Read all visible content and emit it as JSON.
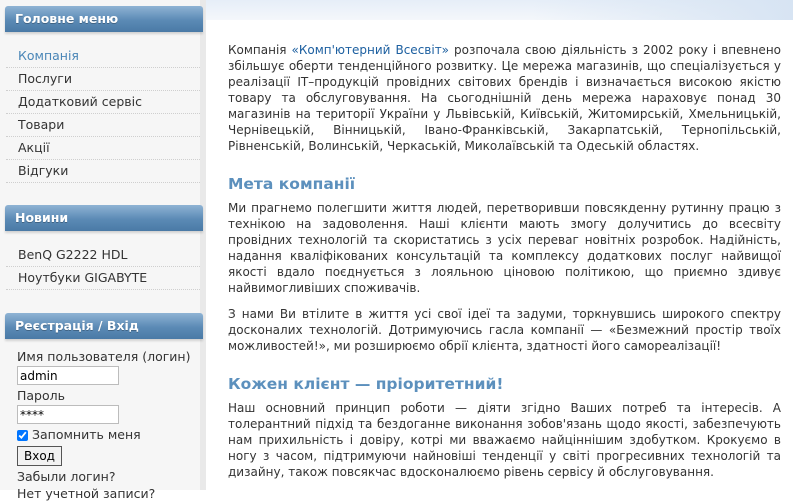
{
  "sidebar": {
    "main_menu": {
      "title": "Головне меню",
      "items": [
        {
          "label": "Компанія",
          "active": true
        },
        {
          "label": "Послуги"
        },
        {
          "label": "Додатковий сервіс"
        },
        {
          "label": "Товари"
        },
        {
          "label": "Акції"
        },
        {
          "label": "Відгуки"
        }
      ]
    },
    "news": {
      "title": "Новини",
      "items": [
        {
          "label": "BenQ G2222 HDL"
        },
        {
          "label": "Ноутбуки GIGABYTE"
        }
      ]
    },
    "login": {
      "title": "Реєстрація / Вхід",
      "username_label": "Имя пользователя (логин)",
      "username_value": "admin",
      "password_label": "Пароль",
      "password_value": "****",
      "remember_label": "Запомнить меня",
      "remember_checked": true,
      "submit_label": "Вход",
      "forgot_login": "Забыли логин?",
      "no_account": "Нет учетной записи?"
    }
  },
  "content": {
    "intro": {
      "before": "Компанія ",
      "brand": "«Комп'ютерний Всесвіт»",
      "after": " розпочала свою діяльність з 2002 року і впевнено збільшує оберти тенденційного розвитку. Це мережа магазинів, що спеціалізується у реалізації IT–продукцій провідних світових брендів і визначається високою якістю товару та обслуговування. На сьогоднішній день мережа нараховує понад 30 магазинів на території України у Львівській, Київській, Житомирській, Хмельницькій, Чернівецькій, Вінницькій, Івано-Франківській, Закарпатській, Тернопільській, Рівненській, Волинській, Черкаській, Миколаївській та Одеській областях."
    },
    "section1": {
      "title": "Мета компанії",
      "p1": "Ми прагнемо полегшити життя людей, перетворивши повсякденну рутинну працю з технікою на задоволення. Наші клієнти мають змогу долучитись до всесвіту провідних технологій та скористатись з усіх переваг новітніх розробок. Надійність, надання кваліфікованих консультацій та комплексу додаткових послуг найвищої якості вдало поєднується з лояльною ціновою політикою, що приємно здивує найвимогливіших споживачів.",
      "p2": "З нами Ви втілите в життя усі свої ідеї та задуми, торкнувшись широкого спектру досконалих технологій. Дотримуючись гасла компанії — «Безмежний простір твоїх можливостей!», ми розширюємо обрії клієнта, здатності його самореалізації!"
    },
    "section2": {
      "title": "Кожен клієнт — пріоритетний!",
      "p1": "Наш основний принцип роботи — діяти згідно Ваших потреб та інтересів. А толерантний підхід та бездоганне виконання зобов'язань щодо якості, забезпечують нам прихильність і довіру, котрі ми вважаємо найціннішим здобутком. Крокуємо в ногу з часом, підтримуючи найновіші тенденції у світі прогресивних технологій та дизайну, також повсякчас вдосконалюємо рівень сервісу й обслуговування."
    }
  }
}
